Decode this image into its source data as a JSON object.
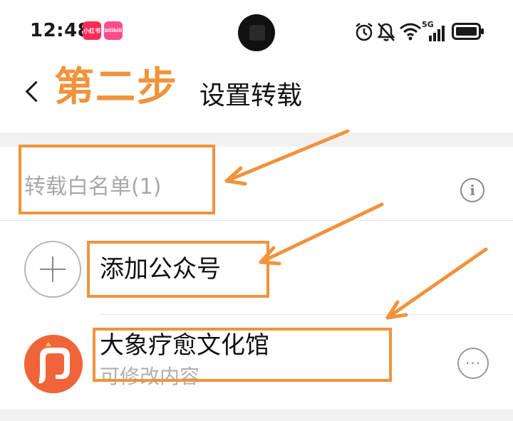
{
  "status_bar": {
    "time": "12:48",
    "app_badges": [
      "小红书",
      "bilibili"
    ],
    "icons": [
      "alarm-icon",
      "mute-icon",
      "wifi-icon",
      "signal-5g-icon",
      "battery-icon"
    ],
    "signal_label": "5G"
  },
  "header": {
    "step_label": "第二步",
    "title": "设置转载"
  },
  "whitelist": {
    "label": "转载白名单(1)",
    "info_glyph": "i"
  },
  "add_account": {
    "label": "添加公众号"
  },
  "account": {
    "name": "大象疗愈文化馆",
    "subtitle": "可修改内容",
    "more_glyph": "···"
  },
  "colors": {
    "accent": "#f0933c",
    "avatar": "#f0643a",
    "muted_text": "#a8a8a8",
    "band": "#f1f1f1"
  }
}
